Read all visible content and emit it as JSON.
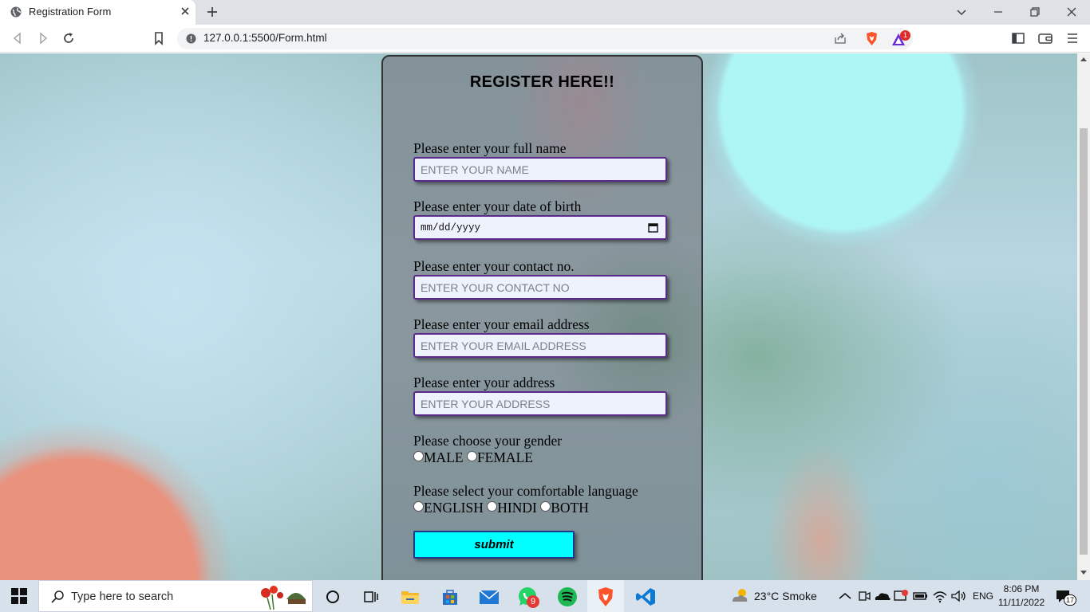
{
  "browser": {
    "tab_title": "Registration Form",
    "url": "127.0.0.1:5500/Form.html",
    "rewards_badge": "1"
  },
  "form": {
    "title": "REGISTER HERE!!",
    "name_label": "Please enter your full name",
    "name_placeholder": "ENTER YOUR NAME",
    "dob_label": "Please enter your date of birth",
    "dob_placeholder": "mm/dd/yyyy",
    "contact_label": "Please enter your contact no.",
    "contact_placeholder": "ENTER YOUR CONTACT NO",
    "email_label": "Please enter your email address",
    "email_placeholder": "ENTER YOUR EMAIL ADDRESS",
    "address_label": "Please enter your address",
    "address_placeholder": "ENTER YOUR ADDRESS",
    "gender_label": "Please choose your gender",
    "gender_options": [
      "MALE",
      "FEMALE"
    ],
    "language_label": "Please select your comfortable language",
    "language_options": [
      "ENGLISH",
      "HINDI",
      "BOTH"
    ],
    "submit_label": "submit"
  },
  "taskbar": {
    "search_placeholder": "Type here to search",
    "whatsapp_badge": "9",
    "weather": "23°C  Smoke",
    "language": "ENG",
    "time": "8:06 PM",
    "date": "11/11/2022",
    "notifications": "17"
  }
}
